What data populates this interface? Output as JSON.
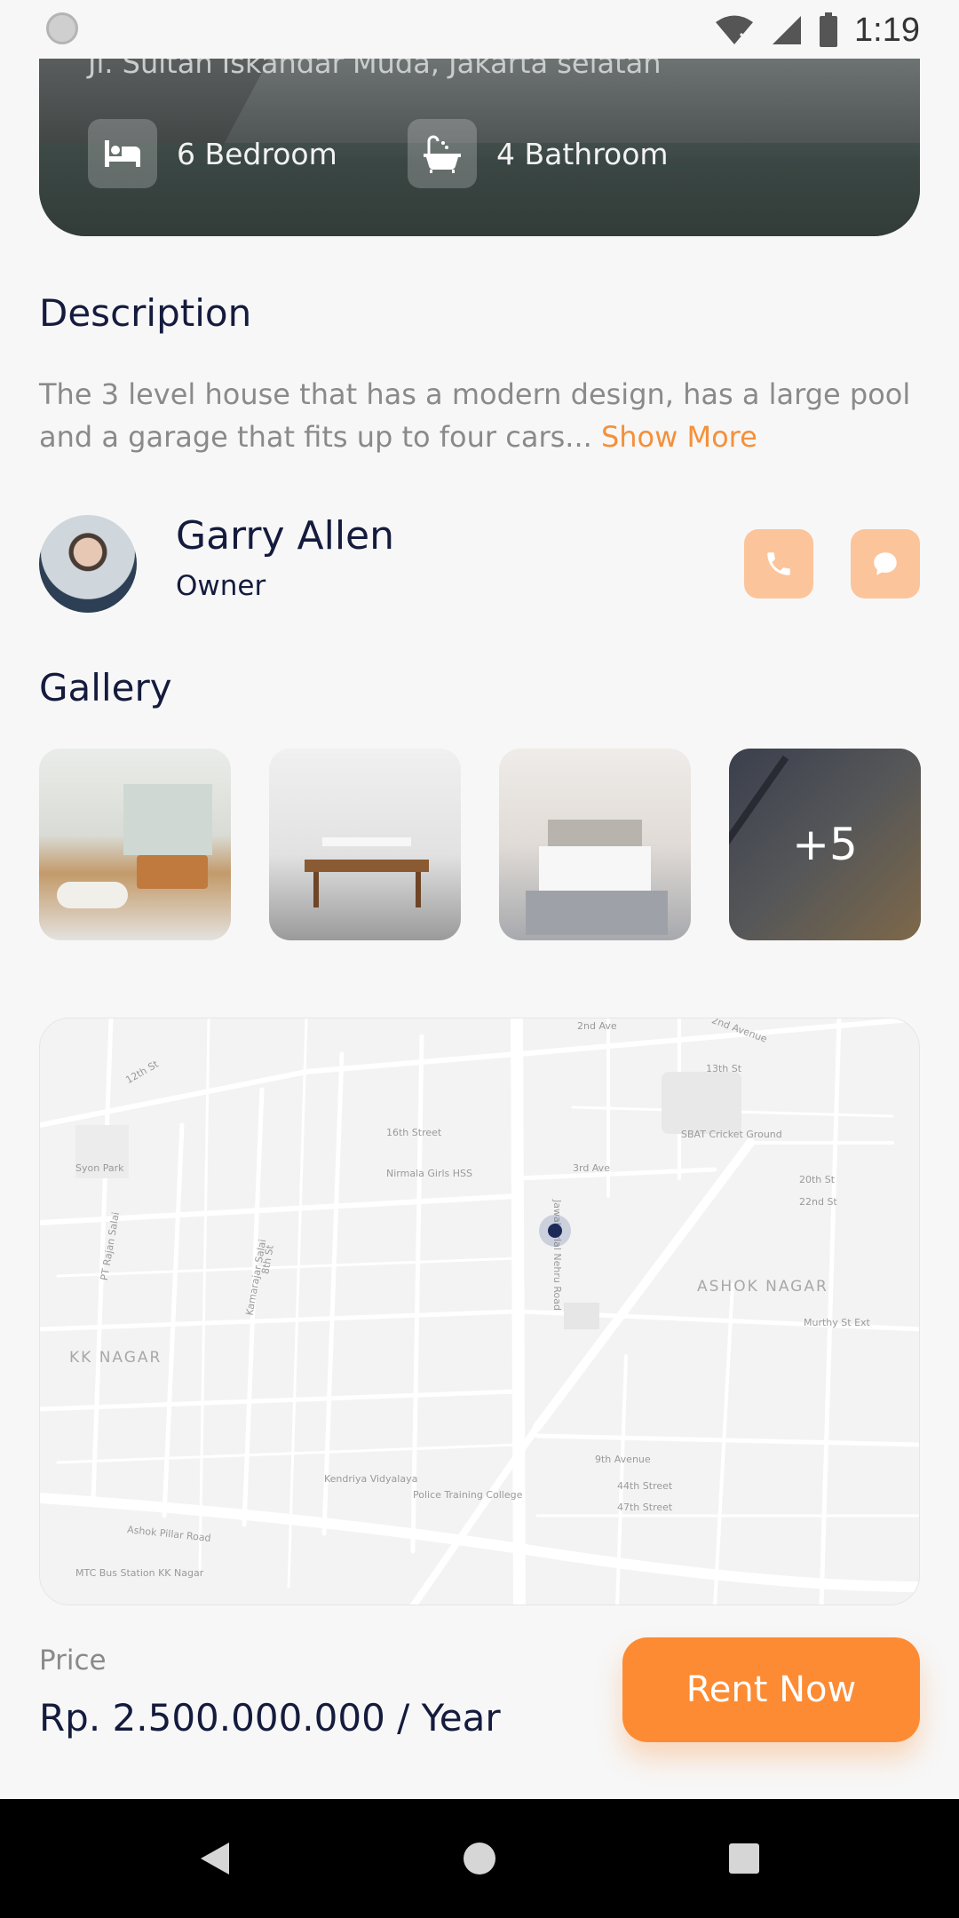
{
  "status_bar": {
    "time": "1:19"
  },
  "property": {
    "address": "Jl. Sultan Iskandar Muda, Jakarta selatan",
    "bedrooms": "6 Bedroom",
    "bathrooms": "4 Bathroom"
  },
  "description": {
    "title": "Description",
    "text": "The 3 level house that has a modern design, has a large pool and a garage that fits up to four cars...",
    "show_more": "Show More"
  },
  "owner": {
    "name": "Garry Allen",
    "role": "Owner"
  },
  "gallery": {
    "title": "Gallery",
    "more_count": "+5"
  },
  "map": {
    "labels": [
      "2nd Ave",
      "2nd Avenue",
      "12th St",
      "13th St",
      "16th Street",
      "3rd Ave",
      "SBAT Cricket Ground",
      "20th St",
      "22nd St",
      "Jawaharlal Nehru Road",
      "Nirmala Girls HSS",
      "Syon Park",
      "PT Rajan Salai",
      "8th St",
      "Kamarajar Salai",
      "Ashok Pillar Road",
      "Police Training College",
      "Kendriya Vidyalaya",
      "Murthy St Ext",
      "9th Avenue",
      "44th Street",
      "47th Street",
      "MTC Bus Station KK Nagar"
    ],
    "areas": [
      "KK NAGAR",
      "ASHOK NAGAR"
    ]
  },
  "footer": {
    "price_label": "Price",
    "price_value": "Rp. 2.500.000.000 / Year",
    "rent_button": "Rent Now"
  },
  "colors": {
    "accent": "#fd8b33",
    "accent_light": "#fcc49b",
    "text_dark": "#141b3d",
    "text_muted": "#8a8a8a"
  }
}
